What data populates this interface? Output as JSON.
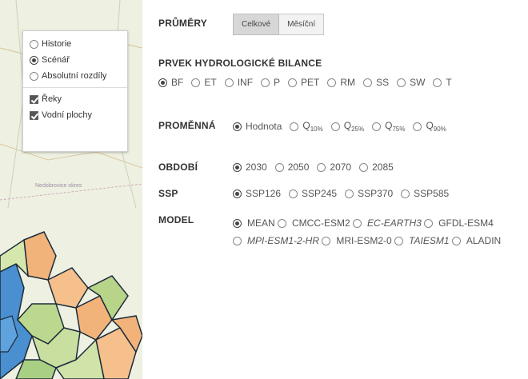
{
  "layers": {
    "history": "Historie",
    "scenario": "Scénář",
    "absolute_diff": "Absolutní rozdíly",
    "rivers": "Řeky",
    "water_bodies": "Vodní plochy",
    "selected": "scenario",
    "map_label": "Nedobrovice okres"
  },
  "averages": {
    "label": "PRŮMĚRY",
    "total": "Celkové",
    "monthly": "Měsíční",
    "active": "total"
  },
  "element": {
    "label": "PRVEK HYDROLOGICKÉ BILANCE",
    "options": [
      "BF",
      "ET",
      "INF",
      "P",
      "PET",
      "RM",
      "SS",
      "SW",
      "T"
    ],
    "selected": "BF"
  },
  "variable": {
    "label": "PROMĚNNÁ",
    "value_option": "Hodnota",
    "q_base": "Q",
    "quantiles": [
      "10%",
      "25%",
      "75%",
      "90%"
    ],
    "selected": "Hodnota"
  },
  "period": {
    "label": "OBDOBÍ",
    "options": [
      "2030",
      "2050",
      "2070",
      "2085"
    ],
    "selected": "2030"
  },
  "ssp": {
    "label": "SSP",
    "options": [
      "SSP126",
      "SSP245",
      "SSP370",
      "SSP585"
    ],
    "selected": "SSP126"
  },
  "model": {
    "label": "MODEL",
    "options": [
      "MEAN",
      "CMCC-ESM2",
      "EC-EARTH3",
      "GFDL-ESM4",
      "MPI-ESM1-2-HR",
      "MRI-ESM2-0",
      "TAIESM1",
      "ALADIN"
    ],
    "selected": "MEAN"
  }
}
